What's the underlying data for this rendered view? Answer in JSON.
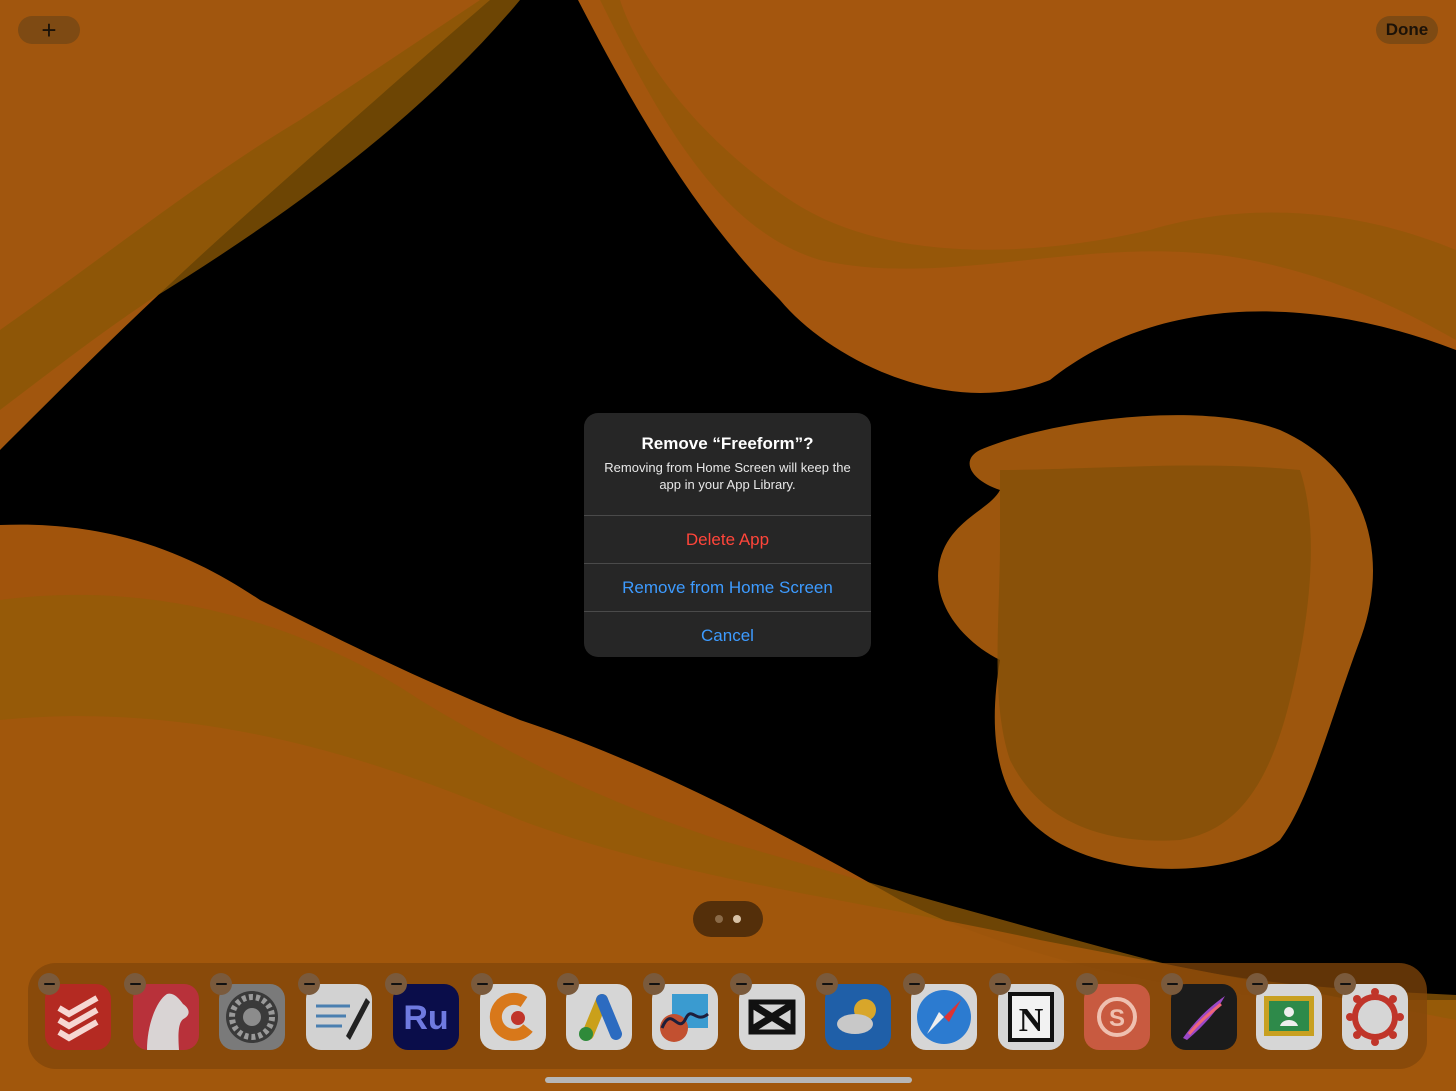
{
  "toolbar": {
    "add_label": "+",
    "done_label": "Done"
  },
  "alert": {
    "title": "Remove “Freeform”?",
    "message": "Removing from Home Screen will keep the app in your App Library.",
    "delete_label": "Delete App",
    "remove_label": "Remove from Home Screen",
    "cancel_label": "Cancel"
  },
  "colors": {
    "destructive": "#ff453a",
    "action": "#3d9bff",
    "wallpaper_orange": "#c86a12",
    "dock_tint": "#82460a"
  },
  "page_indicator": {
    "pages": 2,
    "current": 2
  },
  "dock": {
    "apps": [
      {
        "icon": "todoist-icon",
        "color": "#b42a22"
      },
      {
        "icon": "bear-icon",
        "color": "#b8313a"
      },
      {
        "icon": "settings-gear-icon",
        "color": "#6f6f6f"
      },
      {
        "icon": "notes-pen-icon",
        "color": "#cfcfcf"
      },
      {
        "icon": "premiere-rush-icon",
        "color": "#0a0d4a",
        "text": "Ru"
      },
      {
        "icon": "c-logo-app-icon",
        "color": "#cfcfcf"
      },
      {
        "icon": "google-ads-icon",
        "color": "#cfcfcf"
      },
      {
        "icon": "freeform-icon",
        "color": "#cfcfcf"
      },
      {
        "icon": "capcut-icon",
        "color": "#cfcfcf"
      },
      {
        "icon": "weather-icon",
        "color": "#1f5fa8"
      },
      {
        "icon": "safari-compass-icon",
        "color": "#cfcfcf"
      },
      {
        "icon": "notion-icon",
        "color": "#cfcfcf"
      },
      {
        "icon": "swipe-s-icon",
        "color": "#c85a40"
      },
      {
        "icon": "procreate-icon",
        "color": "#1b1b1b"
      },
      {
        "icon": "google-classroom-icon",
        "color": "#cfcfcf"
      },
      {
        "icon": "canvas-lms-icon",
        "color": "#cfcfcf"
      }
    ]
  }
}
